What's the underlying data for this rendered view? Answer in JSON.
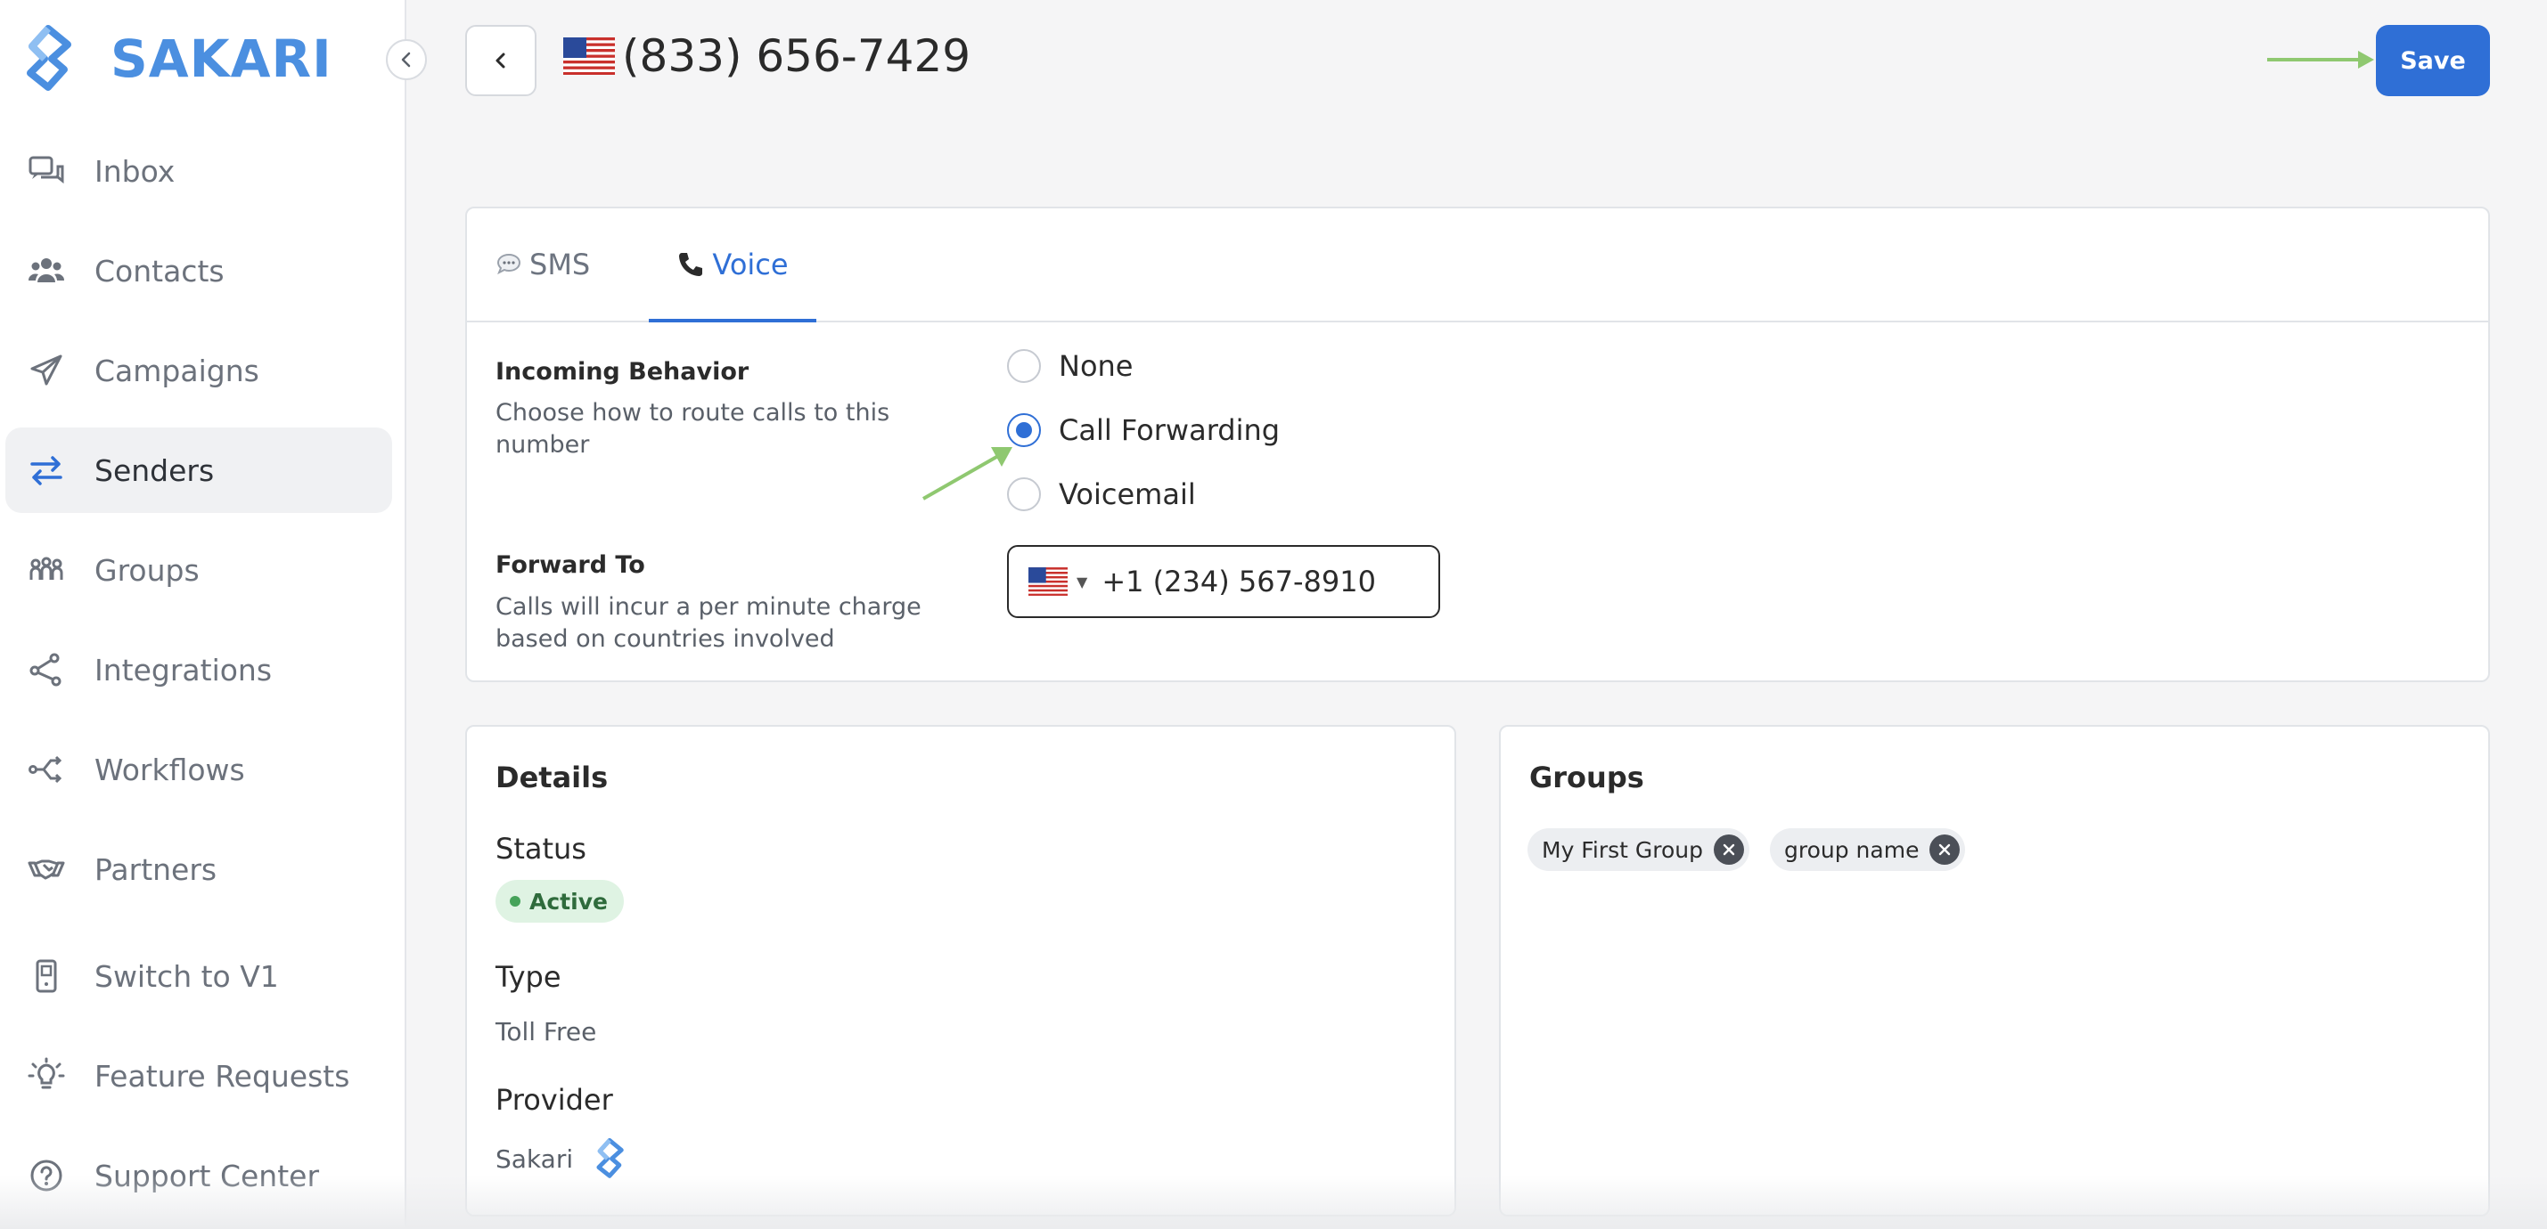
{
  "app": {
    "name": "SAKARI",
    "brand_color": "#4b8fe0",
    "accent_color": "#2f6fd6"
  },
  "sidebar": {
    "items": [
      {
        "label": "Inbox",
        "icon": "inbox-icon"
      },
      {
        "label": "Contacts",
        "icon": "contacts-icon"
      },
      {
        "label": "Campaigns",
        "icon": "paper-plane-icon"
      },
      {
        "label": "Senders",
        "icon": "arrows-swap-icon",
        "active": true
      },
      {
        "label": "Groups",
        "icon": "groups-icon"
      },
      {
        "label": "Integrations",
        "icon": "share-nodes-icon"
      },
      {
        "label": "Workflows",
        "icon": "workflow-icon"
      },
      {
        "label": "Partners",
        "icon": "handshake-icon"
      },
      {
        "label": "Switch to V1",
        "icon": "phone-device-icon"
      },
      {
        "label": "Feature Requests",
        "icon": "lightbulb-icon"
      },
      {
        "label": "Support Center",
        "icon": "help-circle-icon"
      }
    ]
  },
  "header": {
    "title": "(833) 656-7429",
    "save_label": "Save"
  },
  "tabs": [
    {
      "label": "SMS",
      "icon": "speech-bubble-icon"
    },
    {
      "label": "Voice",
      "icon": "telephone-icon",
      "active": true
    }
  ],
  "voice": {
    "incoming_title": "Incoming Behavior",
    "incoming_desc": "Choose how to route calls to this number",
    "options": [
      {
        "label": "None",
        "checked": false
      },
      {
        "label": "Call Forwarding",
        "checked": true
      },
      {
        "label": "Voicemail",
        "checked": false
      }
    ],
    "forward_title": "Forward To",
    "forward_desc": "Calls will incur a per minute charge based on countries involved",
    "forward_value": "+1 (234) 567-8910"
  },
  "details": {
    "title": "Details",
    "status_label": "Status",
    "status_value": "Active",
    "type_label": "Type",
    "type_value": "Toll Free",
    "provider_label": "Provider",
    "provider_value": "Sakari"
  },
  "groups": {
    "title": "Groups",
    "chips": [
      "My First Group",
      "group name"
    ]
  }
}
